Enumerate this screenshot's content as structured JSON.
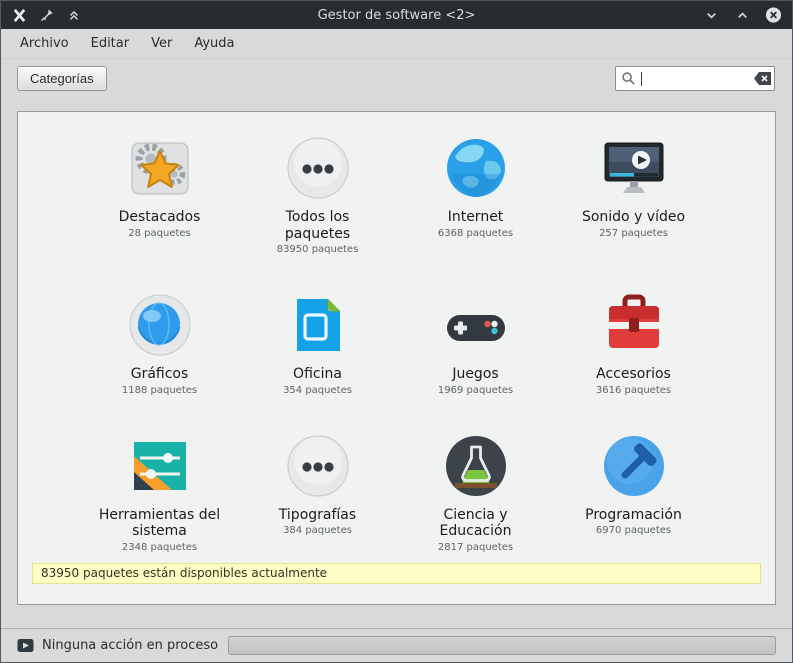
{
  "window": {
    "title": "Gestor de software <2>"
  },
  "menubar": {
    "items": [
      {
        "label": "Archivo"
      },
      {
        "label": "Editar"
      },
      {
        "label": "Ver"
      },
      {
        "label": "Ayuda"
      }
    ]
  },
  "toolbar": {
    "categories_button": "Categorías",
    "search": {
      "value": "",
      "placeholder": ""
    }
  },
  "categories": [
    {
      "name": "Destacados",
      "count": "28 paquetes",
      "icon": "gears-star-icon"
    },
    {
      "name": "Todos los paquetes",
      "count": "83950 paquetes",
      "icon": "dots-circle-icon"
    },
    {
      "name": "Internet",
      "count": "6368 paquetes",
      "icon": "globe-icon"
    },
    {
      "name": "Sonido y vídeo",
      "count": "257 paquetes",
      "icon": "monitor-play-icon"
    },
    {
      "name": "Gráficos",
      "count": "1188 paquetes",
      "icon": "sphere-icon"
    },
    {
      "name": "Oficina",
      "count": "354 paquetes",
      "icon": "document-icon"
    },
    {
      "name": "Juegos",
      "count": "1969 paquetes",
      "icon": "gamepad-icon"
    },
    {
      "name": "Accesorios",
      "count": "3616 paquetes",
      "icon": "toolbox-icon"
    },
    {
      "name": "Herramientas del sistema",
      "count": "2348 paquetes",
      "icon": "sliders-icon"
    },
    {
      "name": "Tipografías",
      "count": "384 paquetes",
      "icon": "dots-circle-icon"
    },
    {
      "name": "Ciencia y Educación",
      "count": "2817 paquetes",
      "icon": "flask-icon"
    },
    {
      "name": "Programación",
      "count": "6970 paquetes",
      "icon": "hammer-icon"
    }
  ],
  "infobar": {
    "message": "83950 paquetes están disponibles actualmente"
  },
  "statusbar": {
    "text": "Ninguna acción en proceso"
  },
  "colors": {
    "titlebar": "#272c31",
    "infobar_bg": "#fdfdc5",
    "panel_bg": "#f1f2f2",
    "toolbox_red": "#e23b3b",
    "teal": "#18b2a8",
    "orange": "#f6a02c",
    "blue": "#2f9bed"
  }
}
